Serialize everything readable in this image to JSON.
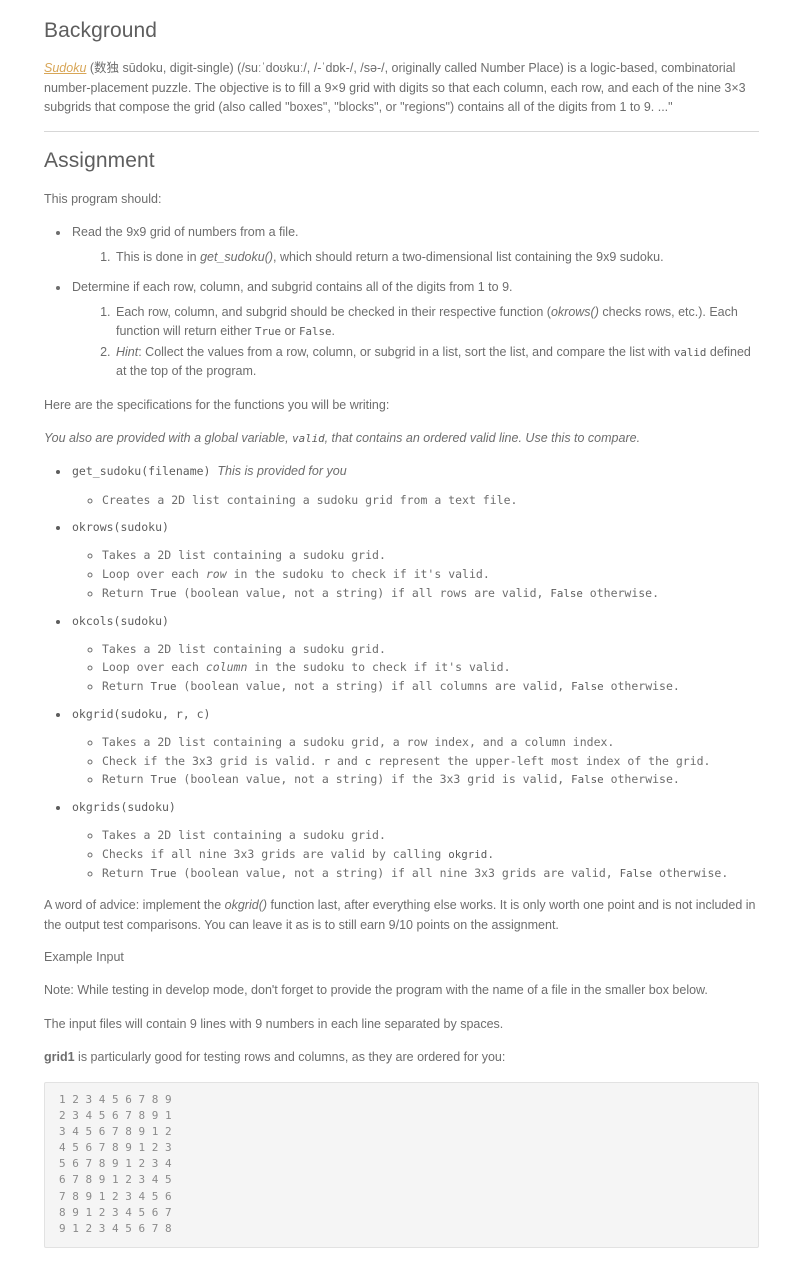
{
  "background": {
    "heading": "Background",
    "link_text": "Sudoku",
    "paragraph_part1": " (数独 sūdoku, digit-single) (/suːˈdoʊkuː/, /-ˈdɒk-/, /sə-/, originally called Number Place) is a logic-based, combinatorial number-placement puzzle. The objective is to fill a 9×9 grid with digits so that each column, each row, and each of the nine 3×3 subgrids that compose the grid (also called \"boxes\", \"blocks\", or \"regions\") contains all of the digits from 1 to 9. ...\""
  },
  "assignment": {
    "heading": "Assignment",
    "intro": "This program should:",
    "items": [
      {
        "text": "Read the 9x9 grid of numbers from a file.",
        "ordered": [
          {
            "pre": "This is done in ",
            "em": "get_sudoku()",
            "post": ", which should return a two-dimensional list containing the 9x9 sudoku."
          }
        ]
      },
      {
        "text": "Determine if each row, column, and subgrid contains all of the digits from 1 to 9.",
        "ordered": [
          {
            "pre": "Each row, column, and subgrid should be checked in their respective function (",
            "em": "okrows()",
            "post": " checks rows, etc.). Each function will return either ",
            "code1": "True",
            "mid": " or ",
            "code2": "False",
            "tail": "."
          },
          {
            "em": "Hint",
            "pre": ": Collect the values from a row, column, or subgrid in a list, sort the list, and compare the list with ",
            "code1": "valid",
            "post": " defined at the top of the program."
          }
        ]
      }
    ],
    "spec_intro": "Here are the specifications for the functions you will be writing:",
    "spec_note_pre": "You also are provided with a global variable, ",
    "spec_note_code": "valid",
    "spec_note_post": ", that contains an ordered valid line. Use this to compare.",
    "functions": [
      {
        "signature": "get_sudoku(filename)",
        "note": "This is provided for you",
        "bullets": [
          {
            "text": "Creates a 2D list containing a sudoku grid from a text file."
          }
        ]
      },
      {
        "signature": "okrows(sudoku)",
        "note": "",
        "bullets": [
          {
            "text": "Takes a 2D list containing a sudoku grid."
          },
          {
            "pre": "Loop over each ",
            "em": "row",
            "post": " in the sudoku to check if it's valid."
          },
          {
            "pre": "Return ",
            "code1": "True",
            "mid": " (boolean value, not a string) if all rows are valid, ",
            "code2": "False",
            "post": " otherwise."
          }
        ]
      },
      {
        "signature": "okcols(sudoku)",
        "note": "",
        "bullets": [
          {
            "text": "Takes a 2D list containing a sudoku grid."
          },
          {
            "pre": "Loop over each ",
            "em": "column",
            "post": " in the sudoku to check if it's valid."
          },
          {
            "pre": "Return ",
            "code1": "True",
            "mid": " (boolean value, not a string) if all columns are valid, ",
            "code2": "False",
            "post": " otherwise."
          }
        ]
      },
      {
        "signature": "okgrid(sudoku, r, c)",
        "note": "",
        "bullets": [
          {
            "text": "Takes a 2D list containing a sudoku grid, a row index, and a column index."
          },
          {
            "pre": "Check if the 3x3 grid is valid. ",
            "code1": "r",
            "mid": " and ",
            "code2": "c",
            "post": " represent the upper-left most index of the grid."
          },
          {
            "pre": "Return ",
            "code1": "True",
            "mid": " (boolean value, not a string) if the 3x3 grid is valid, ",
            "code2": "False",
            "post": " otherwise."
          }
        ]
      },
      {
        "signature": "okgrids(sudoku)",
        "note": "",
        "bullets": [
          {
            "text": "Takes a 2D list containing a sudoku grid."
          },
          {
            "pre": "Checks if all nine 3x3 grids are valid by calling ",
            "code1": "okgrid",
            "post": "."
          },
          {
            "pre": "Return ",
            "code1": "True",
            "mid": " (boolean value, not a string) if all nine 3x3 grids are valid, ",
            "code2": "False",
            "post": " otherwise."
          }
        ]
      }
    ],
    "advice_pre": "A word of advice: implement the ",
    "advice_em": "okgrid()",
    "advice_post": " function last, after everything else works. It is only worth one point and is not included in the output test comparisons. You can leave it as is to still earn 9/10 points on the assignment."
  },
  "example_input": {
    "heading": "Example Input",
    "note": "Note: While testing in develop mode, don't forget to provide the program with the name of a file in the smaller box below.",
    "line2": "The input files will contain 9 lines with 9 numbers in each line separated by spaces.",
    "line3_bold": "grid1",
    "line3_rest": " is particularly good for testing rows and columns, as they are ordered for you:",
    "grid_rows": [
      "1 2 3 4 5 6 7 8 9",
      "2 3 4 5 6 7 8 9 1",
      "3 4 5 6 7 8 9 1 2",
      "4 5 6 7 8 9 1 2 3",
      "5 6 7 8 9 1 2 3 4",
      "6 7 8 9 1 2 3 4 5",
      "7 8 9 1 2 3 4 5 6",
      "8 9 1 2 3 4 5 6 7",
      "9 1 2 3 4 5 6 7 8"
    ]
  },
  "colors": {
    "link": "#d8a657",
    "text": "#6d6d6d",
    "heading": "#5e5e5e",
    "code_bg": "#f5f5f5",
    "code_border": "#e2e2e2",
    "rule": "#d7d7d7"
  }
}
